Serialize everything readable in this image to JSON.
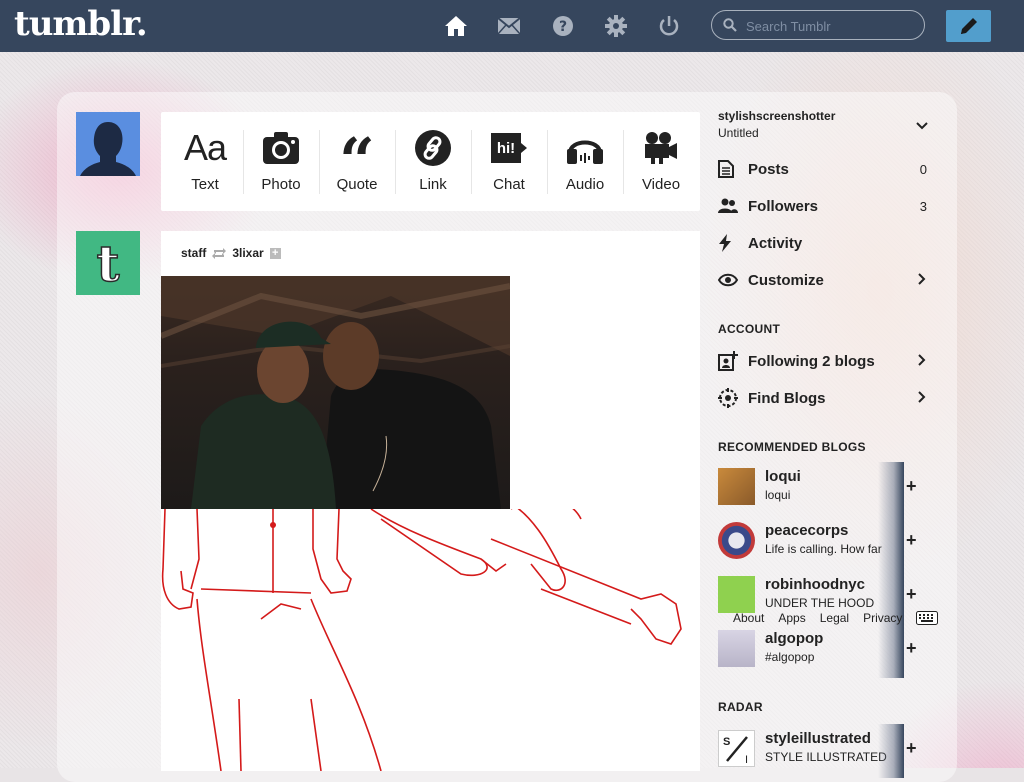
{
  "app": {
    "logo": "tumblr."
  },
  "header": {
    "nav": [
      {
        "name": "home",
        "icon": "home-icon"
      },
      {
        "name": "messages",
        "icon": "envelope-icon"
      },
      {
        "name": "help",
        "icon": "help-icon"
      },
      {
        "name": "settings",
        "icon": "gear-icon"
      },
      {
        "name": "logout",
        "icon": "power-icon"
      }
    ],
    "search_placeholder": "Search Tumblr",
    "compose_icon": "pencil-icon"
  },
  "post_types": [
    {
      "label": "Text",
      "icon": "text-icon"
    },
    {
      "label": "Photo",
      "icon": "camera-icon"
    },
    {
      "label": "Quote",
      "icon": "quote-icon"
    },
    {
      "label": "Link",
      "icon": "link-icon"
    },
    {
      "label": "Chat",
      "icon": "chat-icon"
    },
    {
      "label": "Audio",
      "icon": "headphones-icon"
    },
    {
      "label": "Video",
      "icon": "video-camera-icon"
    }
  ],
  "post": {
    "author": "staff",
    "reblogged_from": "3lixar"
  },
  "sidebar": {
    "blog_name": "stylishscreenshotter",
    "blog_title": "Untitled",
    "items": [
      {
        "label": "Posts",
        "count": "0",
        "icon": "document-icon"
      },
      {
        "label": "Followers",
        "count": "3",
        "icon": "people-icon"
      },
      {
        "label": "Activity",
        "icon": "lightning-icon"
      },
      {
        "label": "Customize",
        "icon": "eye-icon"
      }
    ],
    "account_heading": "ACCOUNT",
    "account_items": [
      {
        "label": "Following 2 blogs",
        "icon": "add-user-icon"
      },
      {
        "label": "Find Blogs",
        "icon": "compass-icon"
      }
    ],
    "recommended_heading": "RECOMMENDED BLOGS",
    "recommended": [
      {
        "name": "loqui",
        "desc": "loqui"
      },
      {
        "name": "peacecorps",
        "desc": "Life is calling. How far"
      },
      {
        "name": "robinhoodnyc",
        "desc": "UNDER THE HOOD"
      },
      {
        "name": "algopop",
        "desc": "#algopop"
      }
    ],
    "footer_links": [
      "About",
      "Apps",
      "Legal",
      "Privacy"
    ],
    "radar_heading": "RADAR",
    "radar": {
      "name": "styleillustrated",
      "desc": "STYLE ILLUSTRATED"
    }
  },
  "colors": {
    "topbar": "#36465d",
    "compose": "#529ecc",
    "tumblr_green": "#41b883",
    "sketch_red": "#d41a1a"
  }
}
